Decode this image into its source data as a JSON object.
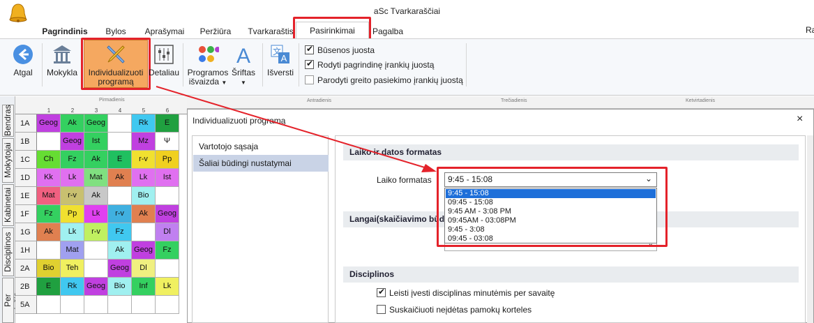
{
  "window": {
    "title": "aSc Tvarkaraščiai",
    "edge_text": "Ra"
  },
  "menu": {
    "tabs": [
      "Pagrindinis",
      "Bylos",
      "Aprašymai",
      "Peržiūra",
      "Tvarkaraštis"
    ],
    "active": "Pasirinkimai",
    "after": "Pagalba"
  },
  "ribbon": {
    "back": "Atgal",
    "school": "Mokykla",
    "custom1": "Individualizuoti",
    "custom2": "programą",
    "detail": "Detaliau",
    "prog1": "Programos",
    "prog2": "išvaizda",
    "font": "Šriftas",
    "translate": "Išversti",
    "options": [
      {
        "label": "Būsenos juosta",
        "checked": true
      },
      {
        "label": "Rodyti pagrindinę įrankių juostą",
        "checked": true
      },
      {
        "label": "Parodyti greito pasiekimo įrankių juostą",
        "checked": false
      }
    ]
  },
  "side_tabs": [
    "Bendras",
    "Mokytojai",
    "Kabinetai",
    "Disciplinos",
    "Per priežiūra"
  ],
  "grid": {
    "day": "Pirmadienis",
    "background_days": [
      "Antradienis",
      "Trečiadienis",
      "Ketvirtadienis"
    ],
    "columns": [
      "1",
      "2",
      "3",
      "4",
      "5",
      "6"
    ],
    "rows": [
      {
        "label": "1A",
        "cells": [
          {
            "t": "Geog",
            "c": "#c040e0"
          },
          {
            "t": "Ak",
            "c": "#34d060"
          },
          {
            "t": "Geog",
            "c": "#34d060"
          },
          {
            "t": "",
            "c": ""
          },
          {
            "t": "Rk",
            "c": "#40c8f0"
          },
          {
            "t": "E",
            "c": "#20a040"
          }
        ]
      },
      {
        "label": "1B",
        "cells": [
          {
            "t": "",
            "c": ""
          },
          {
            "t": "Geog",
            "c": "#c040e0"
          },
          {
            "t": "Ist",
            "c": "#34d060"
          },
          {
            "t": "",
            "c": ""
          },
          {
            "t": "Mz",
            "c": "#c040e0"
          },
          {
            "t": "Ψ",
            "c": ""
          }
        ]
      },
      {
        "label": "1C",
        "cells": [
          {
            "t": "Ch",
            "c": "#66dd33"
          },
          {
            "t": "Fz",
            "c": "#34d060"
          },
          {
            "t": "Ak",
            "c": "#34d060"
          },
          {
            "t": "E",
            "c": "#20c060"
          },
          {
            "t": "r-v",
            "c": "#f0e030"
          },
          {
            "t": "Pp",
            "c": "#f0d020"
          }
        ]
      },
      {
        "label": "1D",
        "cells": [
          {
            "t": "Kk",
            "c": "#e070f0"
          },
          {
            "t": "Lk",
            "c": "#e070f0"
          },
          {
            "t": "Mat",
            "c": "#80e080"
          },
          {
            "t": "Ak",
            "c": "#e08050"
          },
          {
            "t": "Lk",
            "c": "#e070f0"
          },
          {
            "t": "Ist",
            "c": "#e070f0"
          }
        ]
      },
      {
        "label": "1E",
        "cells": [
          {
            "t": "Mat",
            "c": "#f06080"
          },
          {
            "t": "r-v",
            "c": "#c8c070"
          },
          {
            "t": "Ak",
            "c": "#c8c8c8"
          },
          {
            "t": "",
            "c": ""
          },
          {
            "t": "Bio",
            "c": "#a0f0f0"
          },
          {
            "t": "",
            "c": ""
          }
        ]
      },
      {
        "label": "1F",
        "cells": [
          {
            "t": "Fz",
            "c": "#34d060"
          },
          {
            "t": "Pp",
            "c": "#f0e030"
          },
          {
            "t": "Lk",
            "c": "#e040f0"
          },
          {
            "t": "r-v",
            "c": "#40b0e0"
          },
          {
            "t": "Ak",
            "c": "#e08050"
          },
          {
            "t": "Geog",
            "c": "#c040e0"
          }
        ]
      },
      {
        "label": "1G",
        "cells": [
          {
            "t": "Ak",
            "c": "#e08050"
          },
          {
            "t": "Lk",
            "c": "#a0f0f0"
          },
          {
            "t": "r-v",
            "c": "#c0f060"
          },
          {
            "t": "Fz",
            "c": "#40c8f0"
          },
          {
            "t": "",
            "c": ""
          },
          {
            "t": "Dl",
            "c": "#c080f0"
          }
        ]
      },
      {
        "label": "1H",
        "cells": [
          {
            "t": "",
            "c": ""
          },
          {
            "t": "Mat",
            "c": "#a0a0f0"
          },
          {
            "t": "",
            "c": ""
          },
          {
            "t": "Ak",
            "c": "#a0f0f0"
          },
          {
            "t": "Geog",
            "c": "#c040e0"
          },
          {
            "t": "Fz",
            "c": "#34d060"
          }
        ]
      },
      {
        "label": "2A",
        "cells": [
          {
            "t": "Bio",
            "c": "#e0d030"
          },
          {
            "t": "Teh",
            "c": "#f0f060"
          },
          {
            "t": "",
            "c": ""
          },
          {
            "t": "Geog",
            "c": "#c040e0"
          },
          {
            "t": "Dl",
            "c": "#f0f080"
          },
          {
            "t": "",
            "c": ""
          }
        ]
      },
      {
        "label": "2B",
        "cells": [
          {
            "t": "E",
            "c": "#20a040"
          },
          {
            "t": "Rk",
            "c": "#40c8f0"
          },
          {
            "t": "Geog",
            "c": "#c040e0"
          },
          {
            "t": "Bio",
            "c": "#a0f0f0"
          },
          {
            "t": "Inf",
            "c": "#34d060"
          },
          {
            "t": "Lk",
            "c": "#f0f060"
          }
        ]
      },
      {
        "label": "5A",
        "cells": [
          {
            "t": "",
            "c": ""
          },
          {
            "t": "",
            "c": ""
          },
          {
            "t": "",
            "c": ""
          },
          {
            "t": "",
            "c": ""
          },
          {
            "t": "",
            "c": ""
          },
          {
            "t": "",
            "c": ""
          }
        ]
      }
    ]
  },
  "dialog": {
    "title": "Individualizuoti programą",
    "close": "×",
    "nav": [
      "Vartotojo sąsaja",
      "Šaliai būdingi nustatymai"
    ],
    "sec1": "Laiko ir datos formatas",
    "time_label": "Laiko formatas",
    "time_value": "9:45 - 15:08",
    "options": [
      "9:45 - 15:08",
      "09:45 - 15:08",
      "9:45 AM - 3:08 PM",
      "09:45AM - 03:08PM",
      "9:45 - 3:08",
      "09:45 - 03:08"
    ],
    "sec2": "Langai(skaičiavimo būdas)",
    "sec3": "Disciplinos",
    "check1": "Leisti įvesti disciplinas minutėmis per savaitę",
    "check2": "Suskaičiuoti neįdėtas pamokų korteles"
  },
  "colors": {
    "highlight": "#e4222a",
    "selected": "#1e6fd9",
    "nav_selected": "#c9d3e6"
  }
}
